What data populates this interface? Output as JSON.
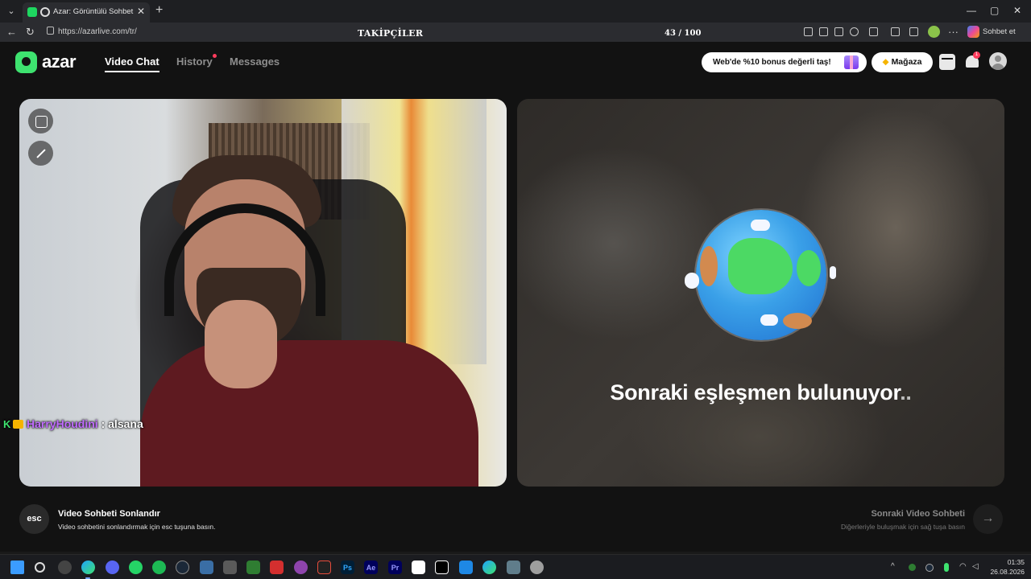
{
  "browser": {
    "tab_title": "Azar: Görüntülü Sohbet & Yeni",
    "url": "https://azarlive.com/tr/",
    "copilot_label": "Sohbet et",
    "window_controls": [
      "—",
      "▢",
      "✕"
    ]
  },
  "overlay": {
    "title": "TAKİPÇİLER",
    "count_label": "43 / 100",
    "progress": 0.43
  },
  "header": {
    "logo": "azar",
    "nav": {
      "video_chat": "Video Chat",
      "history": "History",
      "messages": "Messages"
    },
    "promo_label": "Web'de %10 bonus değerli taş!",
    "store_label": "Mağaza",
    "notification_count": "1"
  },
  "chat": {
    "badge": "K",
    "username": "HarryHoudini",
    "separator": " : ",
    "message": "alsana"
  },
  "matching": {
    "status_text": "Sonraki eşleşmen bulunuyor",
    "dots": ".."
  },
  "footer": {
    "esc_key": "esc",
    "end_title": "Video Sohbeti Sonlandır",
    "end_sub": "Video sohbetini sonlandırmak için esc tuşuna basın.",
    "next_title": "Sonraki Video Sohbeti",
    "next_sub": "Diğerleriyle buluşmak için sağ tuşa basın",
    "next_arrow": "→"
  },
  "taskbar": {
    "time": "01:35",
    "date": "26.08.2026",
    "app_labels": {
      "photoshop": "Ps",
      "after_effects": "Ae",
      "premiere": "Pr"
    }
  },
  "colors": {
    "brand_green": "#3ee26f",
    "username_purple": "#c16cff",
    "notification_red": "#ff3b5c"
  }
}
